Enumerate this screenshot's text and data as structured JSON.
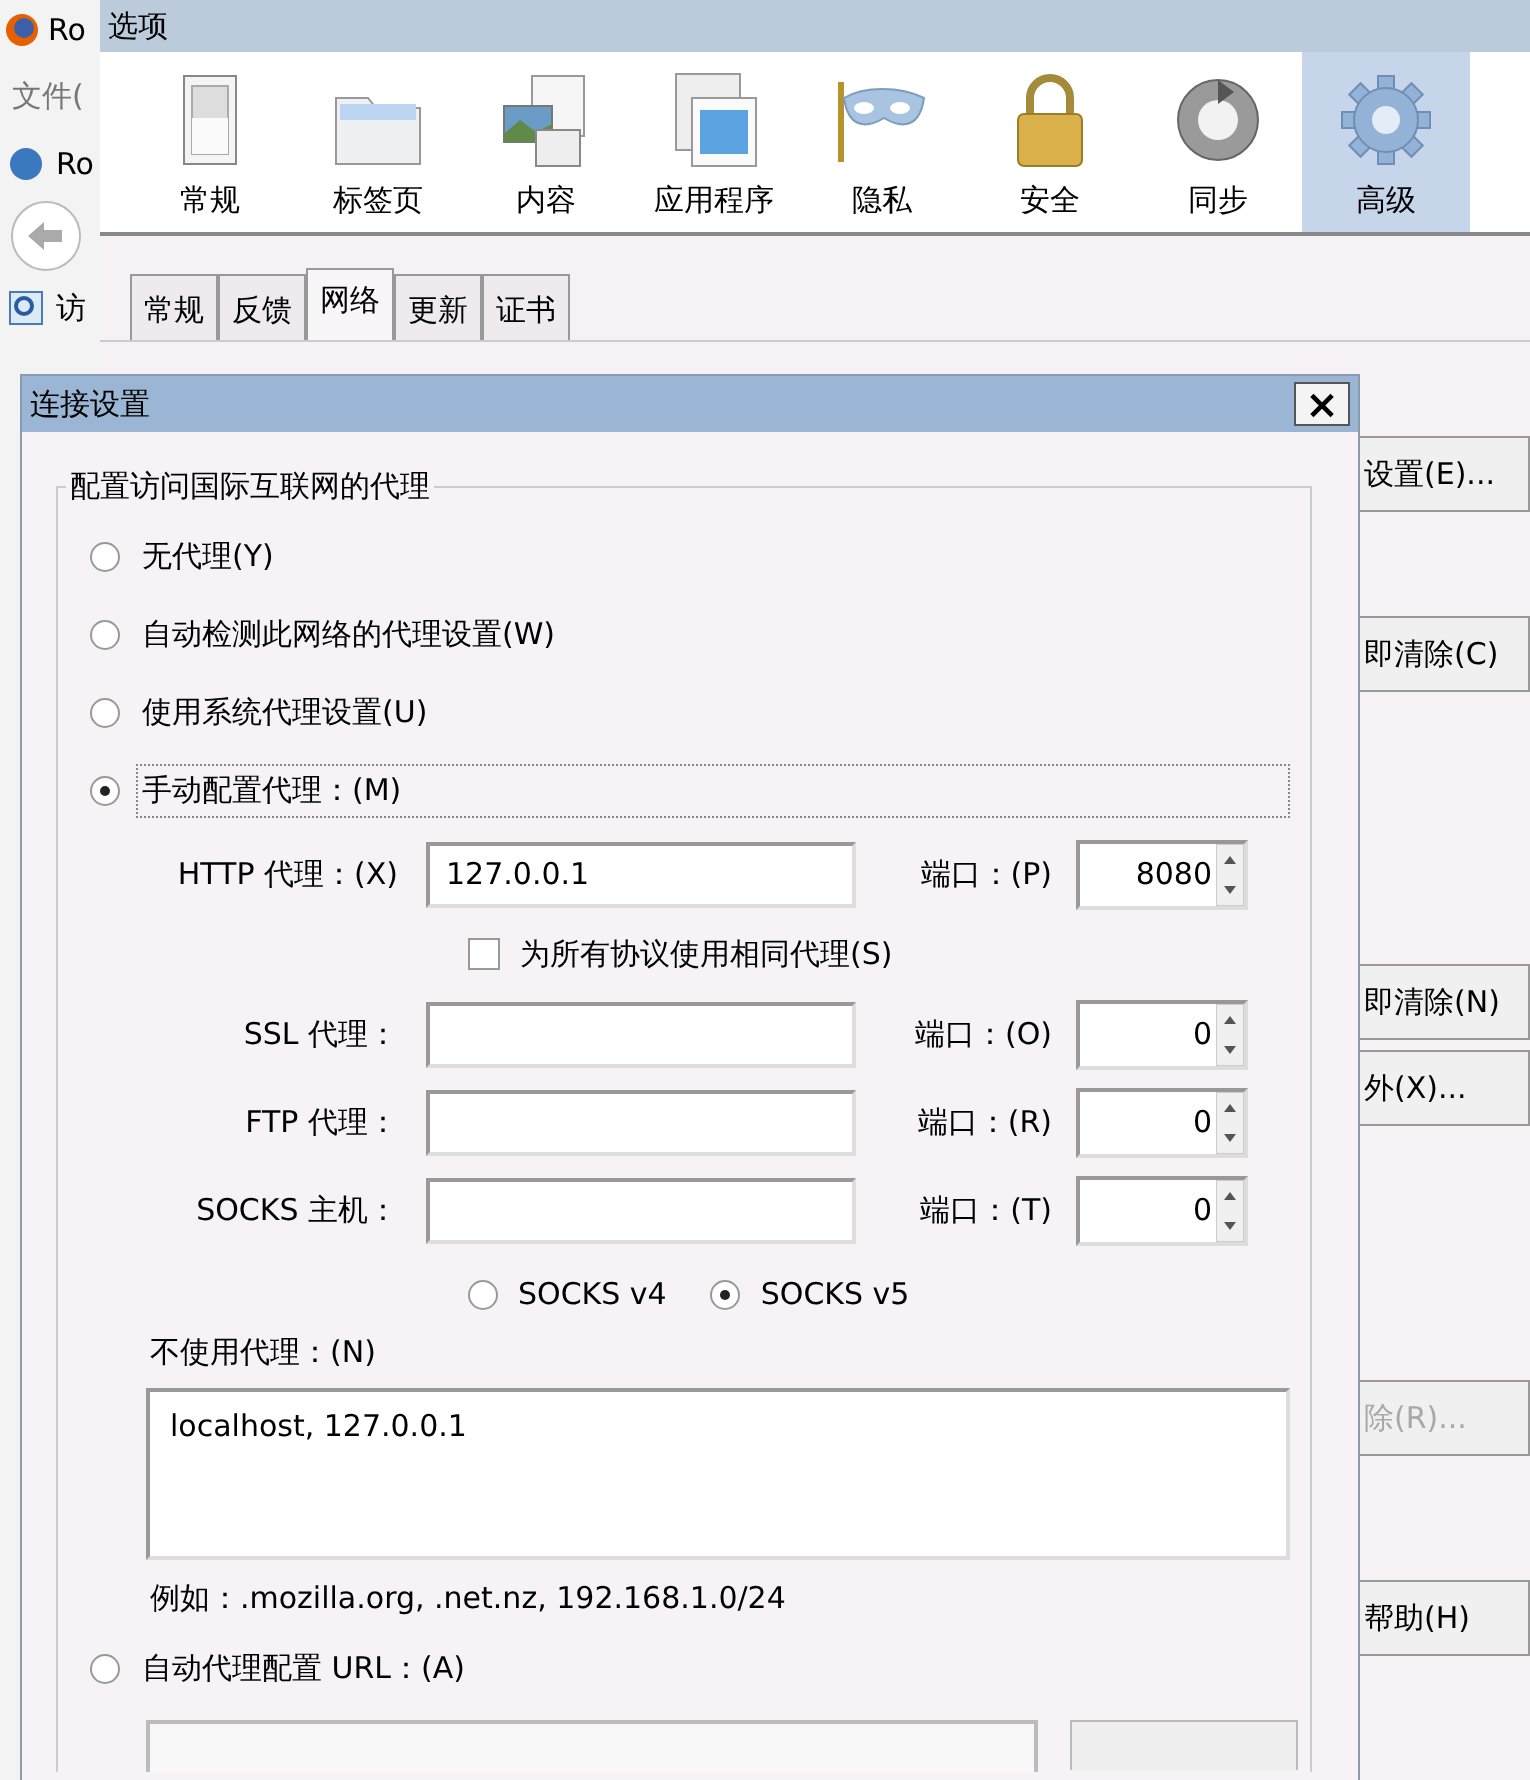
{
  "browser": {
    "title": "Ro",
    "menu": "文件(",
    "tab": "Ro",
    "sidebar_item": "访"
  },
  "options": {
    "title": "选项",
    "toolbar": [
      {
        "label": "常规",
        "kind": "switch",
        "selected": false
      },
      {
        "label": "标签页",
        "kind": "folder",
        "selected": false
      },
      {
        "label": "内容",
        "kind": "content",
        "selected": false
      },
      {
        "label": "应用程序",
        "kind": "apps",
        "selected": false
      },
      {
        "label": "隐私",
        "kind": "mask",
        "selected": false
      },
      {
        "label": "安全",
        "kind": "lock",
        "selected": false
      },
      {
        "label": "同步",
        "kind": "sync",
        "selected": false
      },
      {
        "label": "高级",
        "kind": "gear",
        "selected": true
      }
    ],
    "tabs": [
      {
        "label": "常规",
        "selected": false
      },
      {
        "label": "反馈",
        "selected": false
      },
      {
        "label": "网络",
        "selected": true
      },
      {
        "label": "更新",
        "selected": false
      },
      {
        "label": "证书",
        "selected": false
      }
    ],
    "side_buttons": [
      {
        "label": "设置(E)...",
        "disabled": false
      },
      {
        "label": "即清除(C)",
        "disabled": false
      },
      {
        "label": "即清除(N)",
        "disabled": false
      },
      {
        "label": "外(X)...",
        "disabled": false
      },
      {
        "label": "除(R)...",
        "disabled": true
      },
      {
        "label": "帮助(H)",
        "disabled": false
      }
    ]
  },
  "dialog": {
    "title": "连接设置",
    "close": "×",
    "group_label": "配置访问国际互联网的代理",
    "modes": [
      {
        "label": "无代理(Y)",
        "selected": false
      },
      {
        "label": "自动检测此网络的代理设置(W)",
        "selected": false
      },
      {
        "label": "使用系统代理设置(U)",
        "selected": false
      },
      {
        "label": "手动配置代理：(M)",
        "selected": true
      },
      {
        "label": "自动代理配置 URL：(A)",
        "selected": false
      }
    ],
    "proxies": [
      {
        "label": "HTTP 代理：(X)",
        "value": "127.0.0.1",
        "port_label": "端口：(P)",
        "port": "8080"
      },
      {
        "label": "SSL 代理：",
        "port_label": "端口：(O)",
        "port": "0"
      },
      {
        "label": "FTP 代理：",
        "port_label": "端口：(R)",
        "port": "0"
      },
      {
        "label": "SOCKS 主机：",
        "port_label": "端口：(T)",
        "port": "0"
      }
    ],
    "same_proxy": {
      "label": "为所有协议使用相同代理(S)",
      "checked": false
    },
    "socks_versions": [
      {
        "label": "SOCKS v4",
        "selected": false
      },
      {
        "label": "SOCKS v5",
        "selected": true
      }
    ],
    "no_proxy_label": "不使用代理：(N)",
    "no_proxy_value": "localhost, 127.0.0.1",
    "example": "例如：.mozilla.org, .net.nz, 192.168.1.0/24"
  }
}
